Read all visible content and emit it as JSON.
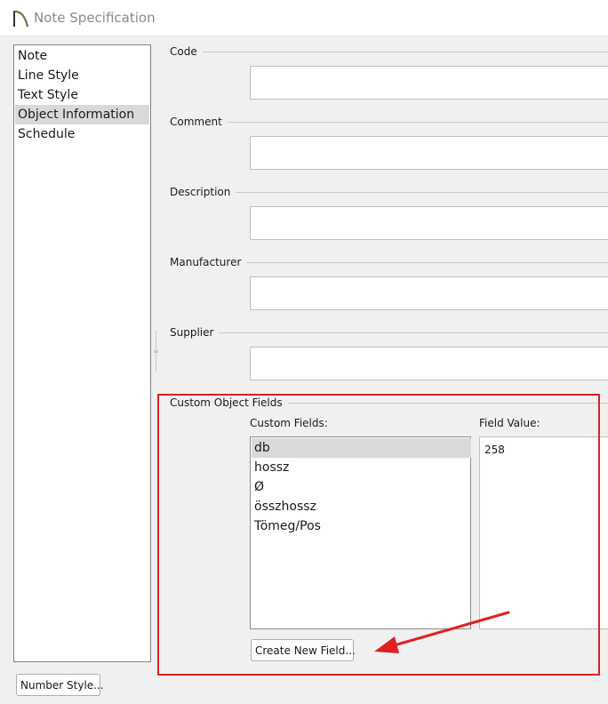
{
  "window": {
    "title": "Note Specification"
  },
  "nav": {
    "items": [
      {
        "label": "Note"
      },
      {
        "label": "Line Style"
      },
      {
        "label": "Text Style"
      },
      {
        "label": "Object Information",
        "selected": true
      },
      {
        "label": "Schedule"
      }
    ]
  },
  "groups": {
    "code": {
      "label": "Code",
      "value": ""
    },
    "comment": {
      "label": "Comment",
      "value": ""
    },
    "description": {
      "label": "Description",
      "value": ""
    },
    "manufacturer": {
      "label": "Manufacturer",
      "value": ""
    },
    "supplier": {
      "label": "Supplier",
      "value": ""
    }
  },
  "custom_fields": {
    "group_label": "Custom Object Fields",
    "fields_label": "Custom Fields:",
    "value_label": "Field Value:",
    "items": [
      {
        "label": "db",
        "selected": true
      },
      {
        "label": "hossz"
      },
      {
        "label": "Ø"
      },
      {
        "label": "összhossz"
      },
      {
        "label": "Tömeg/Pos"
      }
    ],
    "selected_value": "258",
    "create_button": "Create New Field..."
  },
  "footer": {
    "number_style_button": "Number Style..."
  },
  "annotation": {
    "highlight_color": "#e02020"
  }
}
